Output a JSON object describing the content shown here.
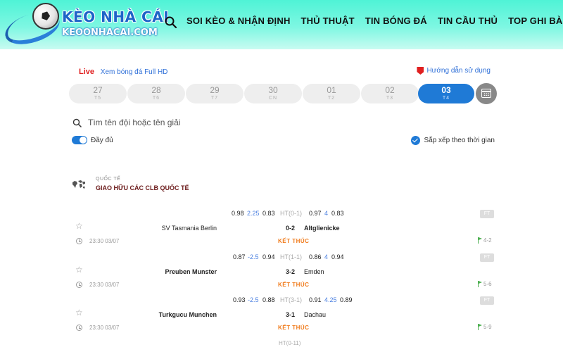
{
  "header": {
    "logo_title": "KÈO NHÀ CÁI",
    "logo_sub": "KEOONHACAI.COM",
    "nav": [
      "SOI KÈO & NHẬN ĐỊNH",
      "THỦ THUẬT",
      "TIN BÓNG ĐÁ",
      "TIN CẦU THỦ",
      "TOP GHI BÀN"
    ],
    "colors": {
      "gradient_top": "#4ff3d6",
      "gradient_bottom": "#c8fbf1"
    }
  },
  "toolbar": {
    "live_badge": "Live",
    "live_link": "Xem bóng đá Full HD",
    "guide_link": "Hướng dẫn sử dụng"
  },
  "dates": [
    {
      "day": "27",
      "weekday": "T5"
    },
    {
      "day": "28",
      "weekday": "T6"
    },
    {
      "day": "29",
      "weekday": "T7"
    },
    {
      "day": "30",
      "weekday": "CN"
    },
    {
      "day": "01",
      "weekday": "T2"
    },
    {
      "day": "02",
      "weekday": "T3"
    },
    {
      "day": "03",
      "weekday": "T4",
      "active": true
    }
  ],
  "search": {
    "placeholder": "Tìm tên đội hoặc tên giải"
  },
  "filters": {
    "full_label": "Đầy đủ",
    "sort_label": "Sắp xếp theo thời gian"
  },
  "league": {
    "region": "QUỐC TẾ",
    "name": "GIAO HỮU CÁC CLB QUỐC TẾ"
  },
  "matches": [
    {
      "odds": [
        "0.98",
        "2.25",
        "0.83",
        "HT(0-1)",
        "0.97",
        "4",
        "0.83"
      ],
      "ft": "FT",
      "home": "SV Tasmania Berlin",
      "score": "0-2",
      "away": "Altglienicke",
      "time": "23:30 03/07",
      "status": "KẾT THÚC",
      "corners": "4-2"
    },
    {
      "odds": [
        "0.87",
        "-2.5",
        "0.94",
        "HT(1-1)",
        "0.86",
        "4",
        "0.94"
      ],
      "ft": "FT",
      "home": "Preuben Munster",
      "score": "3-2",
      "away": "Emden",
      "time": "23:30 03/07",
      "status": "KẾT THÚC",
      "corners": "5-6"
    },
    {
      "odds": [
        "0.93",
        "-2.5",
        "0.88",
        "HT(3-1)",
        "0.91",
        "4.25",
        "0.89"
      ],
      "ft": "FT",
      "home": "Turkgucu Munchen",
      "score": "3-1",
      "away": "Dachau",
      "time": "23:30 03/07",
      "status": "KẾT THÚC",
      "corners": "5-9"
    }
  ],
  "last_ht": "HT(0-11)"
}
